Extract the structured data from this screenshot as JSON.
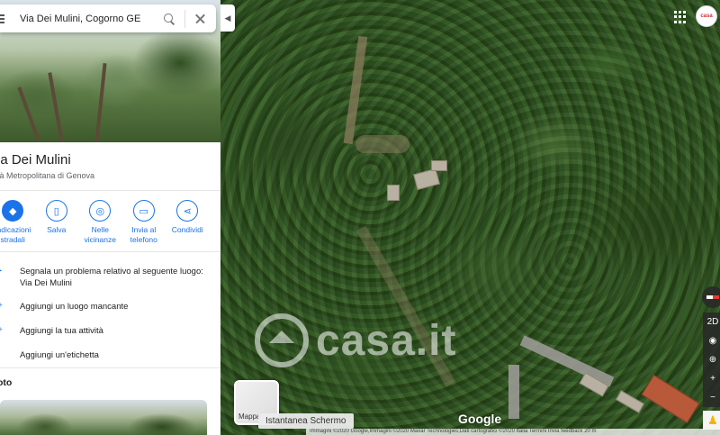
{
  "search": {
    "query": "Via Dei Mulini, Cogorno GE"
  },
  "place": {
    "title": "ia Dei Mulini",
    "subtitle": "tà Metropolitana di Genova"
  },
  "actions": [
    {
      "label": "Indicazioni\nstradali",
      "icon": "directions-icon"
    },
    {
      "label": "Salva",
      "icon": "bookmark-icon"
    },
    {
      "label": "Nelle\nvicinanze",
      "icon": "nearby-icon"
    },
    {
      "label": "Invia al\ntelefono",
      "icon": "send-to-phone-icon"
    },
    {
      "label": "Condividi",
      "icon": "share-icon"
    }
  ],
  "list": [
    {
      "text": "Segnala un problema relativo al seguente luogo: Via Dei Mulini"
    },
    {
      "text": "Aggiungi un luogo mancante"
    },
    {
      "text": "Aggiungi la tua attività"
    },
    {
      "text": "Aggiungi un'etichetta"
    }
  ],
  "photos_heading": "oto",
  "map": {
    "watermark": "casa.it",
    "google_logo": "Google",
    "thumb_label": "Mappa",
    "screenshot_label": "Istantanea Schermo",
    "attribution": "Immagini ©2020 Google,Immagini ©2020 Maxar Technologies,Dati cartografici ©2020   Italia   Termini   Invia feedback   20 m",
    "controls": {
      "view_toggle": "2D"
    }
  },
  "colors": {
    "accent": "#1a73e8"
  }
}
